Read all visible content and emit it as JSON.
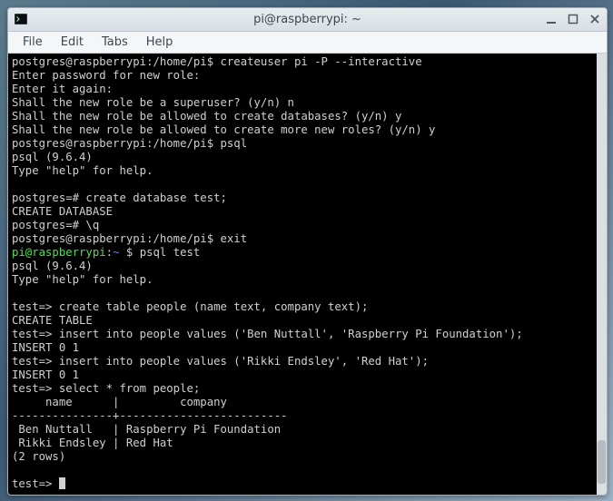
{
  "window": {
    "title": "pi@raspberrypi: ~"
  },
  "menu": {
    "file": "File",
    "edit": "Edit",
    "tabs": "Tabs",
    "help": "Help"
  },
  "term": {
    "l1": "postgres@raspberrypi:/home/pi$ createuser pi -P --interactive",
    "l2": "Enter password for new role:",
    "l3": "Enter it again:",
    "l4": "Shall the new role be a superuser? (y/n) n",
    "l5": "Shall the new role be allowed to create databases? (y/n) y",
    "l6": "Shall the new role be allowed to create more new roles? (y/n) y",
    "l7": "postgres@raspberrypi:/home/pi$ psql",
    "l8": "psql (9.6.4)",
    "l9": "Type \"help\" for help.",
    "l10": "",
    "l11": "postgres=# create database test;",
    "l12": "CREATE DATABASE",
    "l13": "postgres=# \\q",
    "l14": "postgres@raspberrypi:/home/pi$ exit",
    "ps_user": "pi@raspberrypi",
    "ps_sep": ":",
    "ps_path": "~ ",
    "ps_dollar": "$ ",
    "ps_cmd": "psql test",
    "l16": "psql (9.6.4)",
    "l17": "Type \"help\" for help.",
    "l18": "",
    "l19": "test=> create table people (name text, company text);",
    "l20": "CREATE TABLE",
    "l21": "test=> insert into people values ('Ben Nuttall', 'Raspberry Pi Foundation');",
    "l22": "INSERT 0 1",
    "l23": "test=> insert into people values ('Rikki Endsley', 'Red Hat');",
    "l24": "INSERT 0 1",
    "l25": "test=> select * from people;",
    "l26": "     name      |         company",
    "l27": "---------------+-------------------------",
    "l28": " Ben Nuttall   | Raspberry Pi Foundation",
    "l29": " Rikki Endsley | Red Hat",
    "l30": "(2 rows)",
    "l31": "",
    "l32": "test=> "
  }
}
